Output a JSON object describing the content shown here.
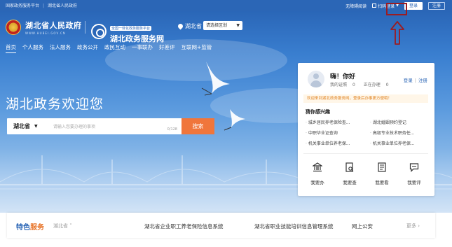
{
  "topbar": {
    "links": [
      "国家政务服务平台",
      "湖北省人民政府"
    ],
    "accessibility": "无障碍阅读",
    "scan_login": "扫码登录",
    "login": "登录",
    "register": "注册"
  },
  "header": {
    "gov_name": "湖北省人民政府",
    "gov_domain": "WWW.HUBEI.GOV.CN",
    "platform_tag": "全国一体化政务服务平台",
    "platform_name": "湖北政务服务网",
    "location": "湖北省",
    "region_select": "请选择区划"
  },
  "nav": [
    "首页",
    "个人服务",
    "法人服务",
    "政务公开",
    "政民互动",
    "一事联办",
    "好差评",
    "互联网+监管"
  ],
  "hero": {
    "welcome": "湖北政务欢迎您",
    "search_scope": "湖北省",
    "search_placeholder": "请输入您要办理的事项",
    "search_count": "0/128",
    "search_button": "搜索"
  },
  "user_card": {
    "greeting": "嗨！你好",
    "certs_label": "我的证照",
    "certs_value": "0",
    "processing_label": "正在办理",
    "processing_value": "0",
    "login": "登录",
    "register": "注册",
    "notice": "欢迎来到湖北政务服务网，登录后办事更方便哦！",
    "interest_title": "猜你感兴趣",
    "interest_links": [
      "城乡居民养老保险查...",
      "湖北婚姻预约登记",
      "中职毕业证查询",
      "高级专业技术职务任...",
      "机关事业单位养老保...",
      "机关事业单位养老保..."
    ],
    "actions": [
      {
        "label": "我要办",
        "icon": "government-building-icon"
      },
      {
        "label": "我要查",
        "icon": "search-document-icon"
      },
      {
        "label": "我要看",
        "icon": "document-view-icon"
      },
      {
        "label": "我要评",
        "icon": "comment-icon"
      }
    ]
  },
  "services": {
    "title_a": "特色",
    "title_b": "服务",
    "region": "湖北省",
    "links": [
      "湖北省企业职工养老保险信息系统",
      "湖北省职业技能培训信息管理系统",
      "网上公安"
    ],
    "more": "更多"
  },
  "colors": {
    "topbar": "#2b66b6",
    "accent_orange": "#f0763c",
    "highlight_red": "#9b1c22"
  }
}
